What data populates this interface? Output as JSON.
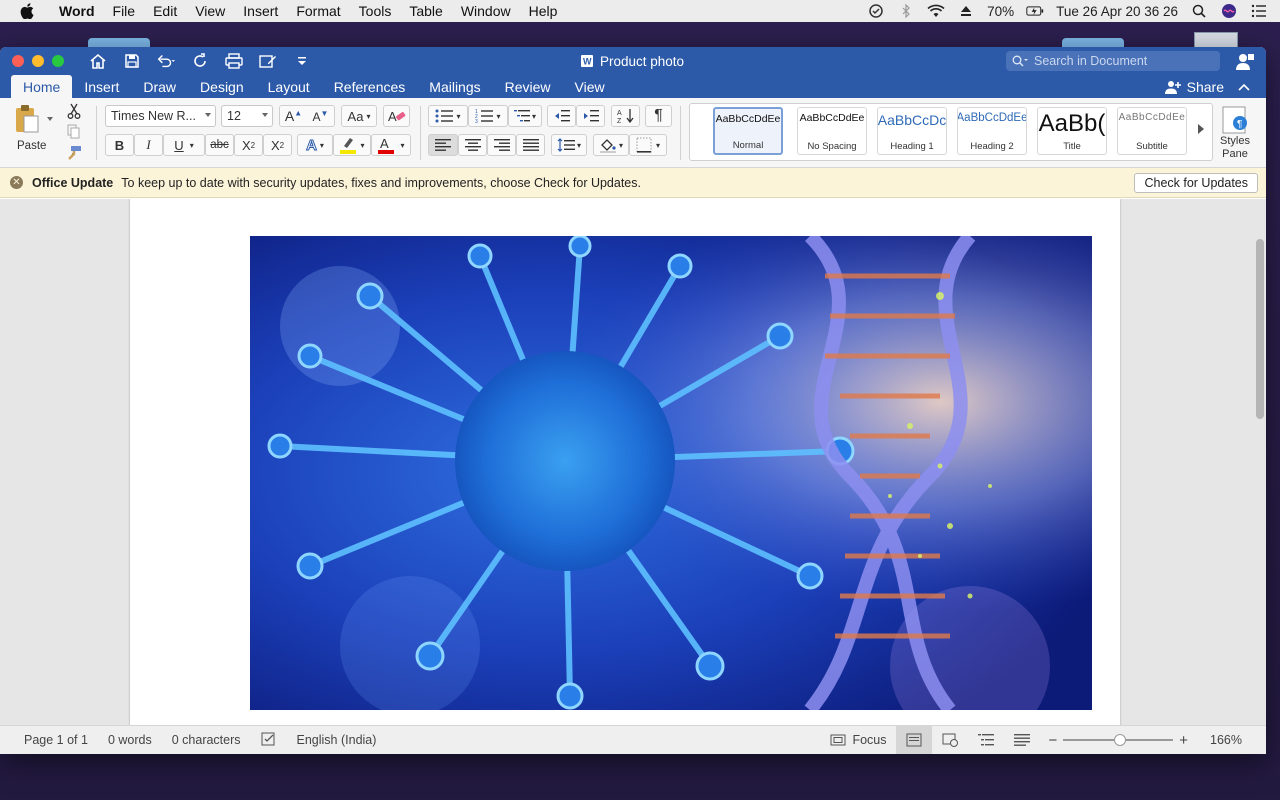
{
  "menubar": {
    "app_name": "Word",
    "items": [
      "File",
      "Edit",
      "View",
      "Insert",
      "Format",
      "Tools",
      "Table",
      "Window",
      "Help"
    ],
    "battery": "70%",
    "datetime": "Tue 26 Apr  20 36 26"
  },
  "window": {
    "title": "Product photo",
    "search_placeholder": "Search in Document",
    "tabs": [
      "Home",
      "Insert",
      "Draw",
      "Design",
      "Layout",
      "References",
      "Mailings",
      "Review",
      "View"
    ],
    "active_tab": "Home",
    "share_label": "Share"
  },
  "ribbon": {
    "paste_label": "Paste",
    "font_name": "Times New R...",
    "font_size": "12",
    "bold": "B",
    "italic": "I",
    "underline": "U",
    "strike": "abc",
    "subscript": "X",
    "superscript": "X",
    "styles": [
      {
        "preview": "AaBbCcDdEe",
        "name": "Normal"
      },
      {
        "preview": "AaBbCcDdEe",
        "name": "No Spacing"
      },
      {
        "preview": "AaBbCcDc",
        "name": "Heading 1"
      },
      {
        "preview": "AaBbCcDdEe",
        "name": "Heading 2"
      },
      {
        "preview": "AaBb(",
        "name": "Title"
      },
      {
        "preview": "AaBbCcDdEe",
        "name": "Subtitle"
      }
    ],
    "styles_pane_label_1": "Styles",
    "styles_pane_label_2": "Pane"
  },
  "update_bar": {
    "title": "Office Update",
    "message": "To keep up to date with security updates, fixes and improvements, choose Check for Updates.",
    "button": "Check for Updates"
  },
  "statusbar": {
    "page": "Page 1 of 1",
    "words": "0 words",
    "characters": "0 characters",
    "language": "English (India)",
    "focus": "Focus",
    "zoom": "166%",
    "zoom_slider_fraction": 0.52
  },
  "colors": {
    "title_blue": "#2c5aa8",
    "update_bar": "#fcf4d9"
  }
}
